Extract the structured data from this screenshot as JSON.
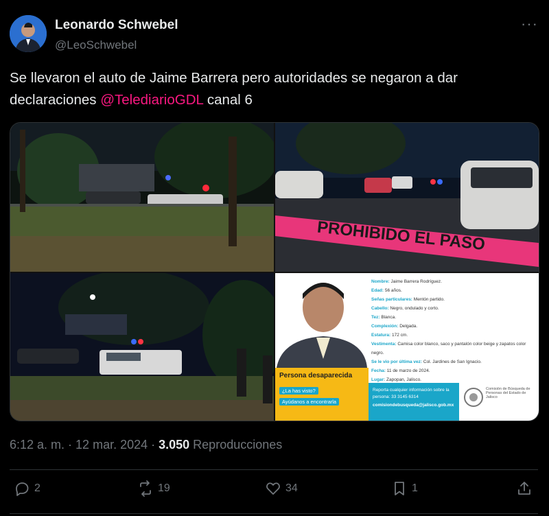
{
  "author": {
    "name": "Leonardo Schwebel",
    "handle": "@LeoSchwebel"
  },
  "more_label": "···",
  "tweet": {
    "text_before": "Se llevaron el auto de Jaime Barrera pero autoridades se negaron a dar declaraciones ",
    "mention": "@TelediarioGDL",
    "text_after": " canal 6"
  },
  "poster": {
    "fields": [
      {
        "k": "Nombre:",
        "v": "Jaime Barrera Rodríguez."
      },
      {
        "k": "Edad:",
        "v": "56 años."
      },
      {
        "k": "Señas particulares:",
        "v": "Mentón partido."
      },
      {
        "k": "Cabello:",
        "v": "Negro, ondulado y corto."
      },
      {
        "k": "Tez:",
        "v": "Blanca."
      },
      {
        "k": "Complexión:",
        "v": "Delgada."
      },
      {
        "k": "Estatura:",
        "v": "172 cm."
      },
      {
        "k": "Vestimenta:",
        "v": "Camisa color blanco, saco y pantalón color beige y zapatos color negro."
      },
      {
        "k": "Se le vio por última vez:",
        "v": "Col. Jardines de San Ignacio."
      },
      {
        "k": "Fecha:",
        "v": "11 de marzo de 2024."
      },
      {
        "k": "Lugar:",
        "v": "Zapopan, Jalisco."
      }
    ],
    "missing_label": "Persona desaparecida",
    "seen_label": "¿La has visto?",
    "help_label": "Ayúdanos a encontrarla",
    "report_text": "Reporta cualquier información sobre la persona: 33 3145 6314",
    "report_email": "comisiondebusqueda@jalisco.gob.mx",
    "agency": "Comisión de Búsqueda de Personas del Estado de Jalisco",
    "tape_text": "PROHIBIDO EL PASO"
  },
  "meta": {
    "time": "6:12 a. m.",
    "sep": " · ",
    "date": "12 mar. 2024",
    "views_count": "3.050",
    "views_label": " Reproducciones"
  },
  "actions": {
    "replies": "2",
    "reposts": "19",
    "likes": "34",
    "bookmarks": "1"
  },
  "colors": {
    "mention": "#f91880",
    "muted": "#71767b",
    "poster_accent": "#1aa6c9",
    "poster_yellow": "#f6b915",
    "tape": "#e8367a"
  }
}
